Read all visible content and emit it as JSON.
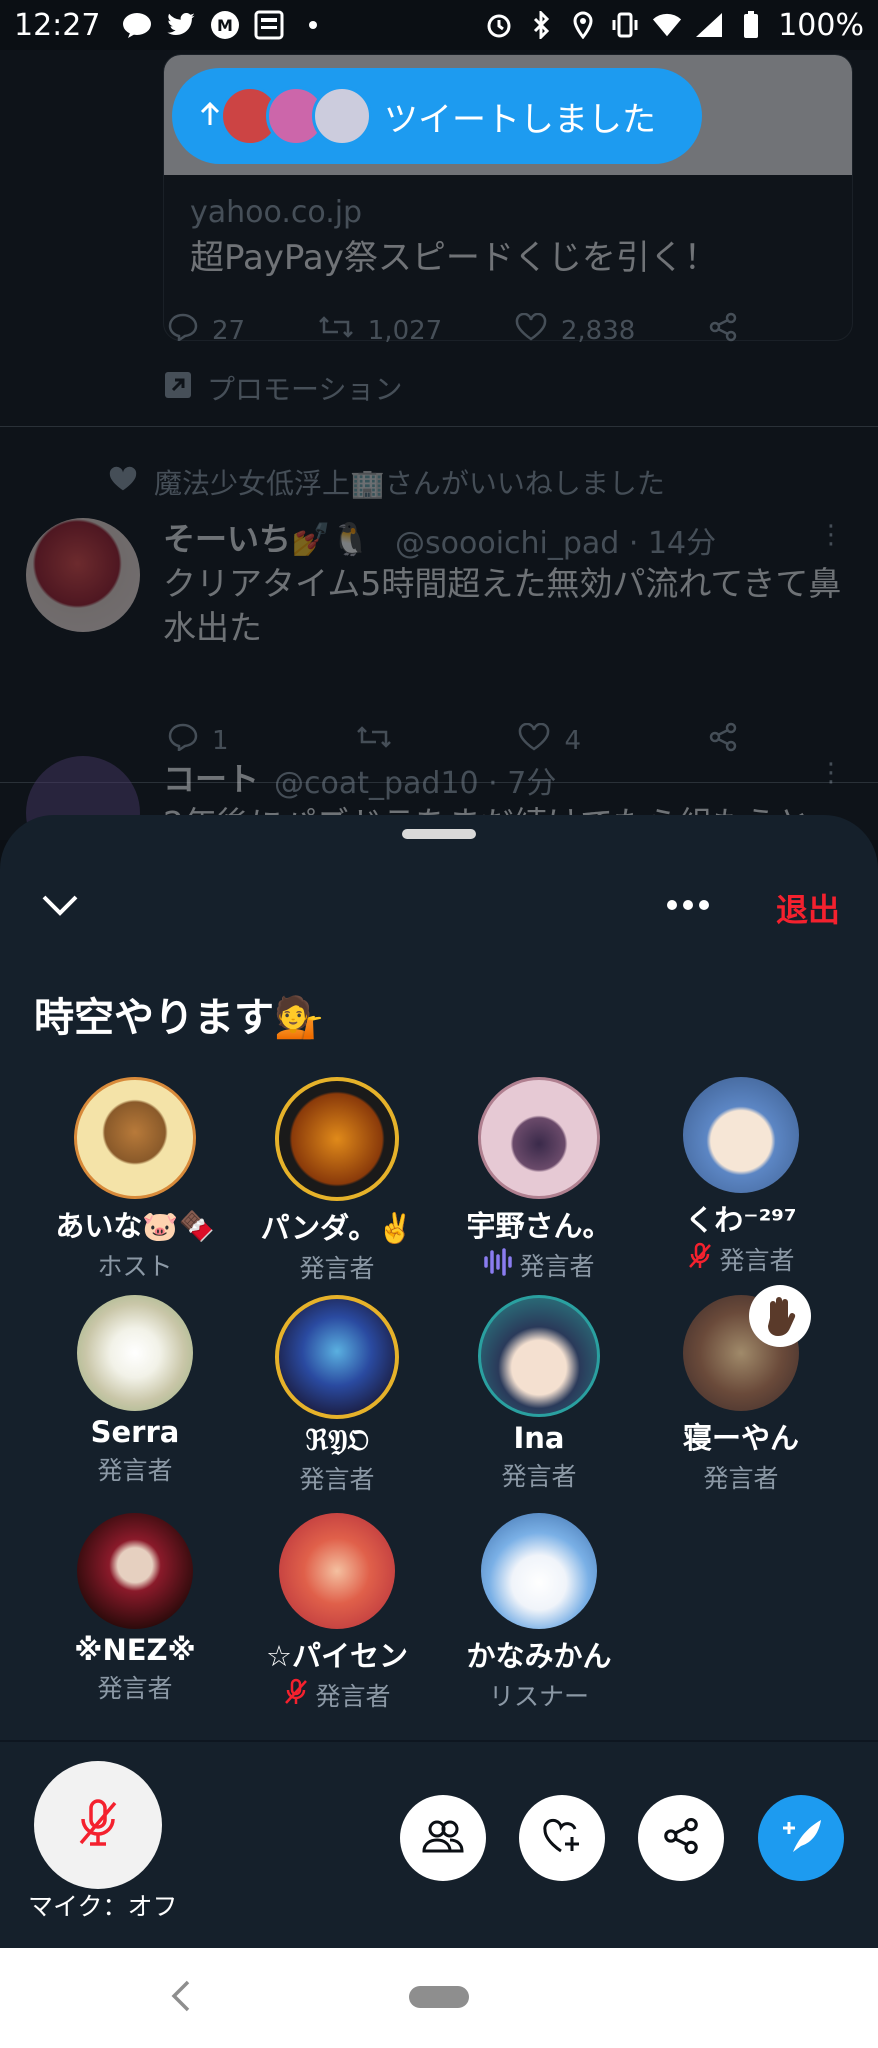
{
  "status_bar": {
    "time": "12:27",
    "battery": "100%",
    "left_icons": [
      "line-icon",
      "twitter-icon",
      "m-app-icon",
      "news-icon",
      "dot-icon"
    ],
    "right_icons": [
      "alarm-icon",
      "bluetooth-icon",
      "location-icon",
      "vibrate-icon",
      "wifi-icon",
      "signal-icon",
      "battery-icon"
    ]
  },
  "feed": {
    "tweeted_pill": "ツイートしました",
    "ad_card": {
      "domain": "yahoo.co.jp",
      "title": "超PayPay祭スピードくじを引く！"
    },
    "ad_actions": {
      "replies": "27",
      "retweets": "1,027",
      "likes": "2,838"
    },
    "promo_label": "プロモーション",
    "liked_note": "魔法少女低浮上🏢さんがいいねしました",
    "tweet1": {
      "name": "そーいち💅🐧",
      "handle": "@soooichi_pad · 14分",
      "text": "クリアタイム5時間超えた無効パ流れてきて鼻水出た",
      "replies": "1",
      "likes": "4"
    },
    "tweet2": {
      "name": "コート",
      "handle": "@coat_pad10 · 7分",
      "text": "2年後にパズドラをまだ続けてたら組もうと"
    }
  },
  "space": {
    "leave_label": "退出",
    "title": "時空やります💁",
    "members": [
      {
        "name": "あいな🐷🍫",
        "role": "ホスト",
        "color": "#e8c26a"
      },
      {
        "name": "パンダ。✌️",
        "role": "発言者",
        "color": "#c99a1a"
      },
      {
        "name": "宇野さん。",
        "role": "発言者",
        "color": "#d9b7c4",
        "speaking": true
      },
      {
        "name": "くわ⁻²⁹⁷",
        "role": "発言者",
        "color": "#7fa9d6",
        "muted": true
      },
      {
        "name": "Serra",
        "role": "発言者",
        "color": "#d8d2b8"
      },
      {
        "name": "ℜ𝔜𝔒",
        "role": "発言者",
        "color": "#2a3a7a"
      },
      {
        "name": "Ina",
        "role": "発言者",
        "color": "#3a8c8a"
      },
      {
        "name": "寝ーやん",
        "role": "発言者",
        "color": "#8a6a4a",
        "hand_raised": true
      },
      {
        "name": "※NEZ※",
        "role": "発言者",
        "color": "#5a1a1a"
      },
      {
        "name": "☆パイセン",
        "role": "発言者",
        "color": "#d86a4a",
        "muted": true
      },
      {
        "name": "かなみかん",
        "role": "リスナー",
        "color": "#9cc3e8"
      }
    ],
    "mic_label": "マイク：オフ"
  }
}
